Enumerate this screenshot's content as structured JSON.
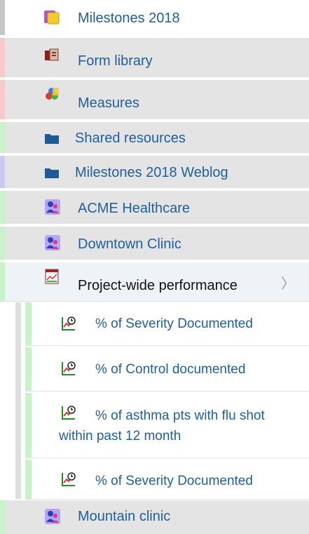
{
  "colors": {
    "row_bg": "#e4e4e4",
    "selected_bg": "#eef3f8",
    "link": "#1f5f9e",
    "stripe_gray": "#c6c6c6",
    "stripe_red": "#f9c8c8",
    "stripe_green": "#c8f3c8",
    "stripe_purple": "#c9c9f4"
  },
  "nav": {
    "items": [
      {
        "label": "Milestones 2018",
        "icon": "milestones-icon"
      },
      {
        "label": "Form library",
        "icon": "form-library-icon"
      },
      {
        "label": "Measures",
        "icon": "measures-icon"
      },
      {
        "label": "Shared resources",
        "icon": "folder-icon"
      },
      {
        "label": "Milestones 2018 Weblog",
        "icon": "folder-icon"
      },
      {
        "label": "ACME Healthcare",
        "icon": "team-icon"
      },
      {
        "label": "Downtown Clinic",
        "icon": "team-icon"
      },
      {
        "label": "Project-wide performance",
        "icon": "chart-icon",
        "chevron": "〉"
      },
      {
        "label": "Mountain clinic",
        "icon": "team-icon"
      }
    ],
    "children": [
      {
        "label": "% of Severity Documented",
        "icon": "measure-chart-icon"
      },
      {
        "label": "% of Control documented",
        "icon": "measure-chart-icon"
      },
      {
        "label_line1": "% of asthma pts with flu shot",
        "label_line2": "within past 12 month",
        "icon": "measure-chart-icon"
      },
      {
        "label": "% of Severity Documented",
        "icon": "measure-chart-icon"
      }
    ]
  }
}
